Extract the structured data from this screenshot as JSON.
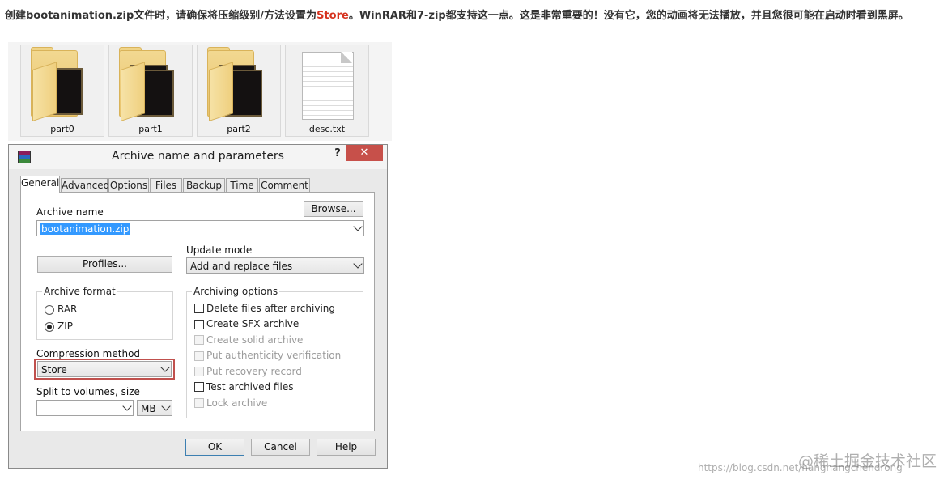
{
  "intro": {
    "before": "创建bootanimation.zip文件时，请确保将压缩级别/方法设置为",
    "highlight": "Store",
    "after": "。WinRAR和7-zip都支持这一点。这是非常重要的！没有它，您的动画将无法播放，并且您很可能在启动时看到黑屏。"
  },
  "gallery": [
    {
      "name": "part0",
      "icon": "folder-icon"
    },
    {
      "name": "part1",
      "icon": "folder-icon"
    },
    {
      "name": "part2",
      "icon": "folder-icon"
    },
    {
      "name": "desc.txt",
      "icon": "text-file-icon"
    }
  ],
  "dialog": {
    "title": "Archive name and parameters",
    "help": "?",
    "close": "✕",
    "tabs": [
      "General",
      "Advanced",
      "Options",
      "Files",
      "Backup",
      "Time",
      "Comment"
    ],
    "archive_name_label": "Archive name",
    "archive_name_value": "bootanimation.zip",
    "browse": "Browse...",
    "profiles": "Profiles...",
    "update_mode_label": "Update mode",
    "update_mode_value": "Add and replace files",
    "archive_format_label": "Archive format",
    "formats": [
      {
        "label": "RAR",
        "selected": false
      },
      {
        "label": "ZIP",
        "selected": true
      }
    ],
    "compression_method_label": "Compression method",
    "compression_method_value": "Store",
    "split_label": "Split to volumes, size",
    "split_value": "",
    "split_unit": "MB",
    "archiving_options_label": "Archiving options",
    "options": [
      {
        "label": "Delete files after archiving",
        "checked": false,
        "enabled": true
      },
      {
        "label": "Create SFX archive",
        "checked": false,
        "enabled": true
      },
      {
        "label": "Create solid archive",
        "checked": false,
        "enabled": false
      },
      {
        "label": "Put authenticity verification",
        "checked": false,
        "enabled": false
      },
      {
        "label": "Put recovery record",
        "checked": false,
        "enabled": false
      },
      {
        "label": "Test archived files",
        "checked": false,
        "enabled": true
      },
      {
        "label": "Lock archive",
        "checked": false,
        "enabled": false
      }
    ],
    "ok": "OK",
    "cancel": "Cancel",
    "help_button": "Help"
  },
  "watermark": {
    "brand": "@稀土掘金技术社区",
    "url": "https://blog.csdn.net/hanghangchendrong"
  },
  "colors": {
    "highlight_text": "#d6331f",
    "highlight_border": "#c0504d",
    "close_button": "#c7504a",
    "selection": "#3399ff"
  }
}
